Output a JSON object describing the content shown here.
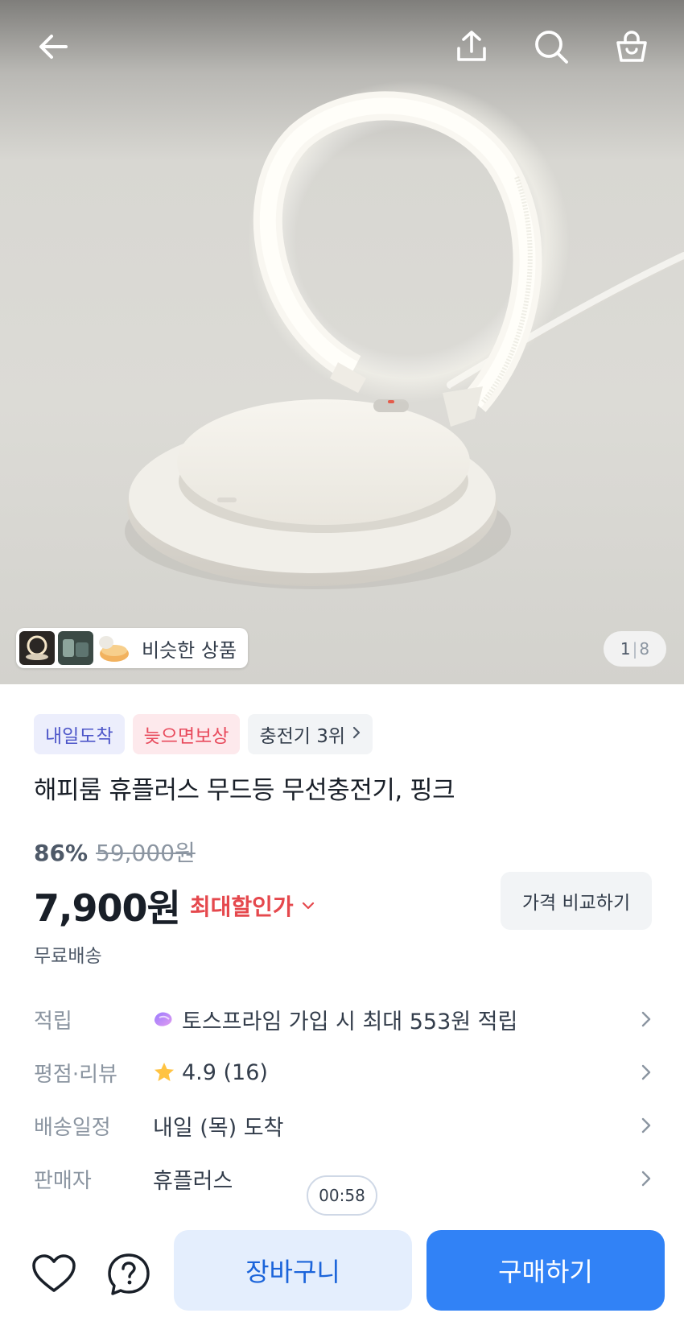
{
  "hero": {
    "similar_label": "비슷한 상품",
    "counter_current": "1",
    "counter_total": "8"
  },
  "icons": {
    "back": "arrow-left-icon",
    "share": "share-icon",
    "search": "search-icon",
    "cart": "shopping-bag-icon",
    "heart": "heart-icon",
    "question": "question-icon",
    "star": "star-icon",
    "point": "toss-prime-icon"
  },
  "badges": {
    "delivery": "내일도착",
    "compensation": "늦으면보상",
    "rank": "충전기 3위"
  },
  "product": {
    "title": "해피룸 휴플러스 무드등 무선충전기, 핑크",
    "discount": "86%",
    "original_price": "59,000원",
    "price": "7,900원",
    "max_discount_label": "최대할인가",
    "compare_label": "가격 비교하기",
    "shipping": "무료배송"
  },
  "info": {
    "points_key": "적립",
    "points_value": "토스프라임 가입 시 최대 553원 적립",
    "rating_key": "평점·리뷰",
    "rating_value": "4.9 (16)",
    "delivery_key": "배송일정",
    "delivery_value": "내일 (목) 도착",
    "seller_key": "판매자",
    "seller_value": "휴플러스"
  },
  "timer": "00:58",
  "bottom": {
    "cart_label": "장바구니",
    "buy_label": "구매하기"
  },
  "colors": {
    "primary": "#3182f6",
    "primary_light": "#e4eefd",
    "discount_red": "#e5484d",
    "star": "#ffc342"
  }
}
